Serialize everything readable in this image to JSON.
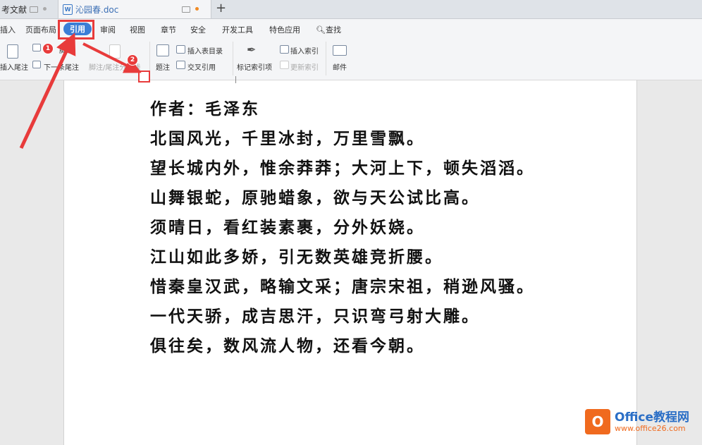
{
  "tabs": [
    {
      "label": "考文献"
    },
    {
      "label": "沁园春.doc"
    }
  ],
  "ribbon_tabs": [
    "插入",
    "页面布局",
    "引用",
    "审阅",
    "视图",
    "章节",
    "安全",
    "开发工具",
    "特色应用",
    "查找"
  ],
  "ribbon": {
    "insert_endnote": "插入尾注",
    "insert_footnote_partial": "脚注",
    "next_endnote": "下一条尾注",
    "footnote_endnote_sep": "脚注/尾注分隔线",
    "caption": "题注",
    "insert_toc_table": "插入表目录",
    "cross_reference": "交叉引用",
    "mark_index": "标记索引项",
    "insert_index": "插入索引",
    "update_index": "更新索引",
    "mail": "邮件"
  },
  "badges": [
    "1",
    "2"
  ],
  "poem": {
    "lines": [
      "作者：毛泽东",
      "北国风光，千里冰封，万里雪飘。",
      "望长城内外，惟余莽莽；大河上下，顿失滔滔。",
      "山舞银蛇，原驰蜡象，欲与天公试比高。",
      "须晴日，看红装素裹，分外妖娆。",
      "江山如此多娇，引无数英雄竞折腰。",
      "惜秦皇汉武，略输文采；唐宗宋祖，稍逊风骚。",
      "一代天骄，成吉思汗，只识弯弓射大雕。",
      "俱往矣，数风流人物，还看今朝。"
    ]
  },
  "watermark": {
    "title": "Office教程网",
    "url": "www.office26.com"
  },
  "colors": {
    "accent": "#3b7ed6",
    "annotation_red": "#e83b3b",
    "watermark_orange": "#f06a1e"
  }
}
